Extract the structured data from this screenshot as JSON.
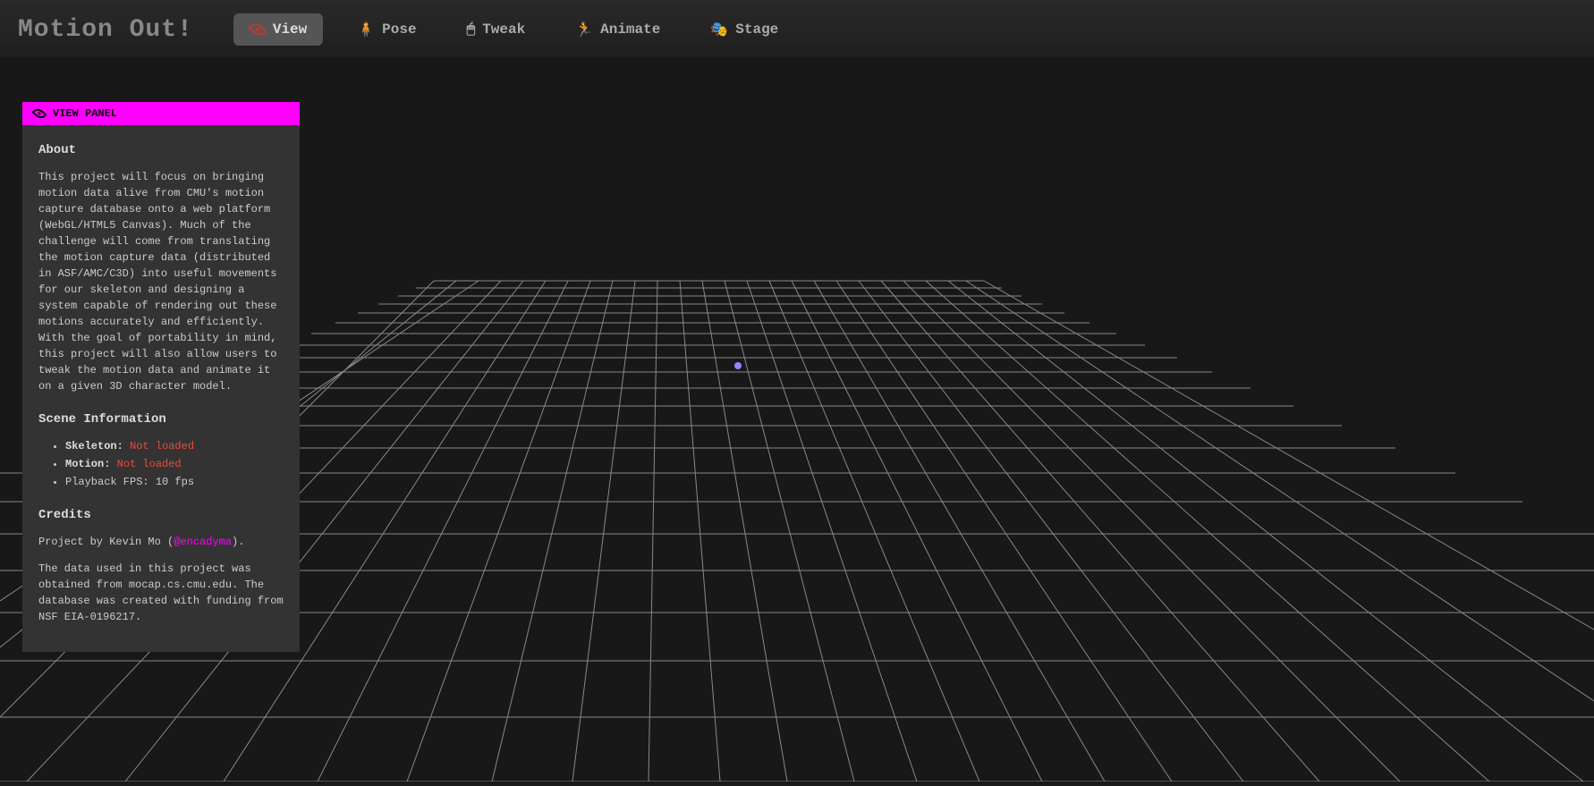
{
  "header": {
    "title": "Motion Out!",
    "tabs": [
      {
        "label": "View",
        "icon": "eye",
        "active": true
      },
      {
        "label": "Pose",
        "icon": "pose",
        "active": false
      },
      {
        "label": "Tweak",
        "icon": "tweak",
        "active": false
      },
      {
        "label": "Animate",
        "icon": "animate",
        "active": false
      },
      {
        "label": "Stage",
        "icon": "stage",
        "active": false
      }
    ]
  },
  "panel": {
    "title": "VIEW PANEL",
    "about": {
      "heading": "About",
      "text": "This project will focus on bringing motion data alive from CMU's motion capture database onto a web platform (WebGL/HTML5 Canvas). Much of the challenge will come from translating the motion capture data (distributed in ASF/AMC/C3D) into useful movements for our skeleton and designing a system capable of rendering out these motions accurately and efficiently. With the goal of portability in mind, this project will also allow users to tweak the motion data and animate it on a given 3D character model."
    },
    "scene": {
      "heading": "Scene Information",
      "skeleton_label": "Skeleton:",
      "skeleton_value": "Not loaded",
      "motion_label": "Motion:",
      "motion_value": "Not loaded",
      "fps_label": "Playback FPS:",
      "fps_value": "10 fps"
    },
    "credits": {
      "heading": "Credits",
      "by_prefix": "Project by Kevin Mo (",
      "handle": "@encadyma",
      "by_suffix": ").",
      "data_text": "The data used in this project was obtained from mocap.cs.cmu.edu. The database was created with funding from NSF EIA-0196217."
    }
  }
}
